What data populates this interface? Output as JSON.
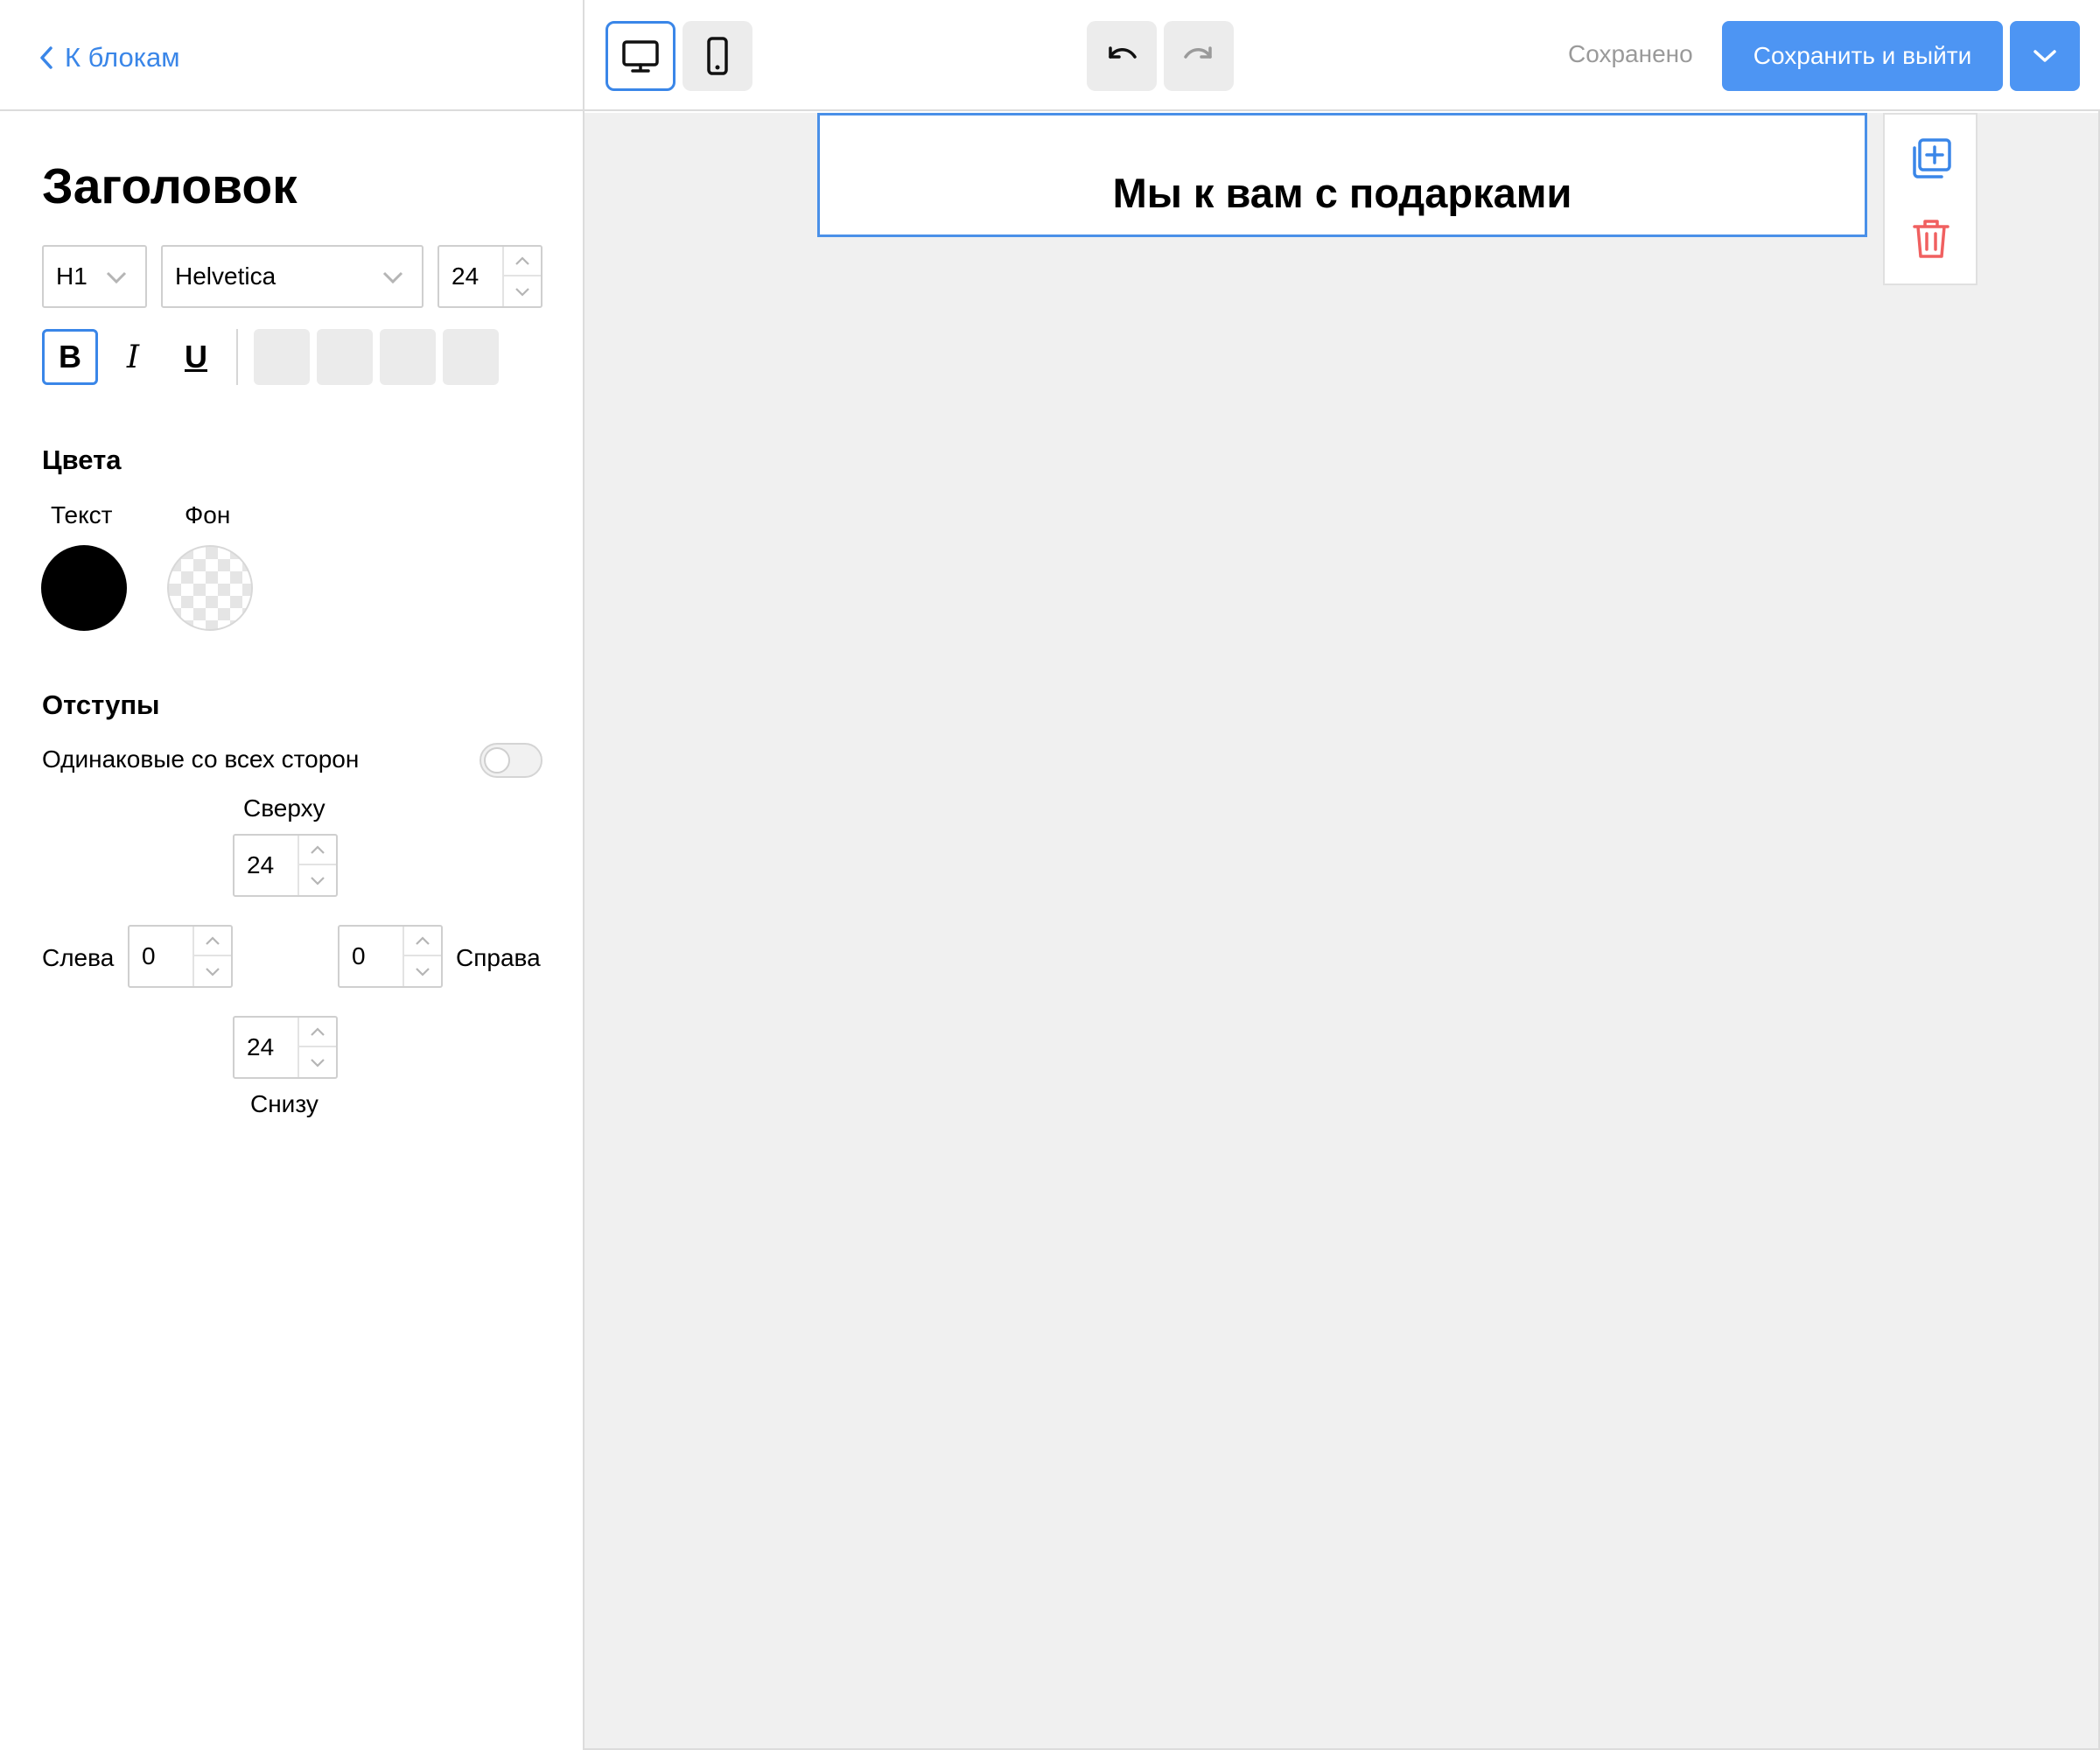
{
  "sidebar": {
    "back_label": "К блокам",
    "title": "Заголовок",
    "heading_level": "H1",
    "font_family": "Helvetica",
    "font_size": "24",
    "format": {
      "bold": "B",
      "italic": "I",
      "underline": "U"
    },
    "colors": {
      "title": "Цвета",
      "text_label": "Текст",
      "bg_label": "Фон",
      "text_color": "#000000"
    },
    "padding": {
      "title": "Отступы",
      "same_all_label": "Одинаковые со всех сторон",
      "same_all_enabled": false,
      "top_label": "Сверху",
      "top_value": "24",
      "left_label": "Слева",
      "left_value": "0",
      "right_label": "Справа",
      "right_value": "0",
      "bottom_value": "24",
      "bottom_label": "Снизу"
    }
  },
  "toolbar": {
    "desktop_icon": "desktop-icon",
    "mobile_icon": "mobile-icon",
    "undo_icon": "undo-icon",
    "redo_icon": "redo-icon",
    "status": "Сохранено",
    "save_label": "Сохранить и выйти",
    "accent_color": "#4d95f3"
  },
  "canvas": {
    "heading_text": "Мы к вам с подарками",
    "actions": [
      "duplicate-icon",
      "trash-icon"
    ]
  }
}
